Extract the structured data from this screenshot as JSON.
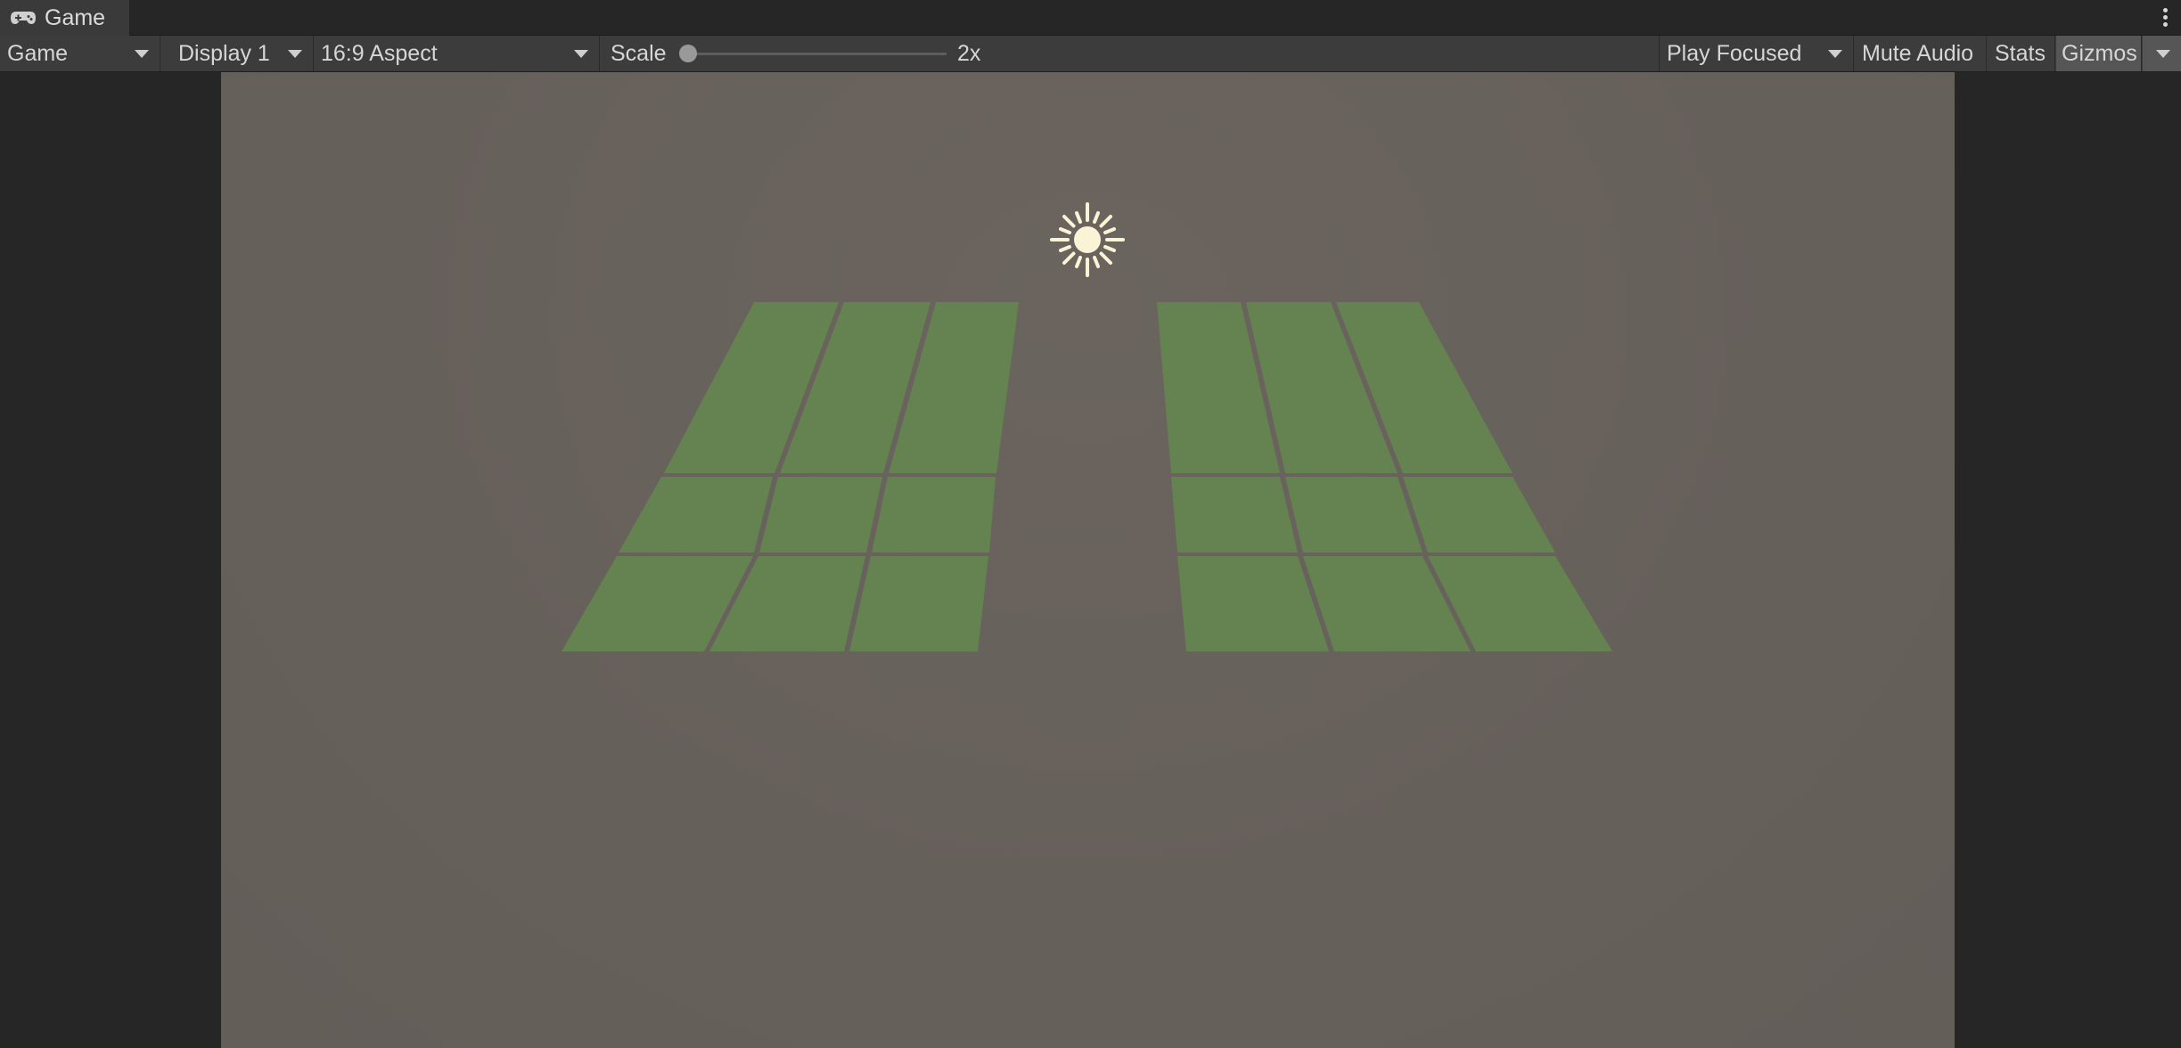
{
  "tab": {
    "label": "Game",
    "icon": "gamepad-icon"
  },
  "toolbar": {
    "view_mode": "Game",
    "display": "Display 1",
    "aspect": "16:9 Aspect",
    "scale_label": "Scale",
    "scale_value": "2x",
    "scale_fraction": 0.0,
    "play_mode": "Play Focused",
    "mute_audio": "Mute Audio",
    "stats": "Stats",
    "gizmos": "Gizmos"
  },
  "scene": {
    "background_color": "#66605b",
    "tile_color": "#648350",
    "light_icon": "sun-icon",
    "left_grid": {
      "rows": 3,
      "cols": 3
    },
    "right_grid": {
      "rows": 3,
      "cols": 3
    }
  }
}
